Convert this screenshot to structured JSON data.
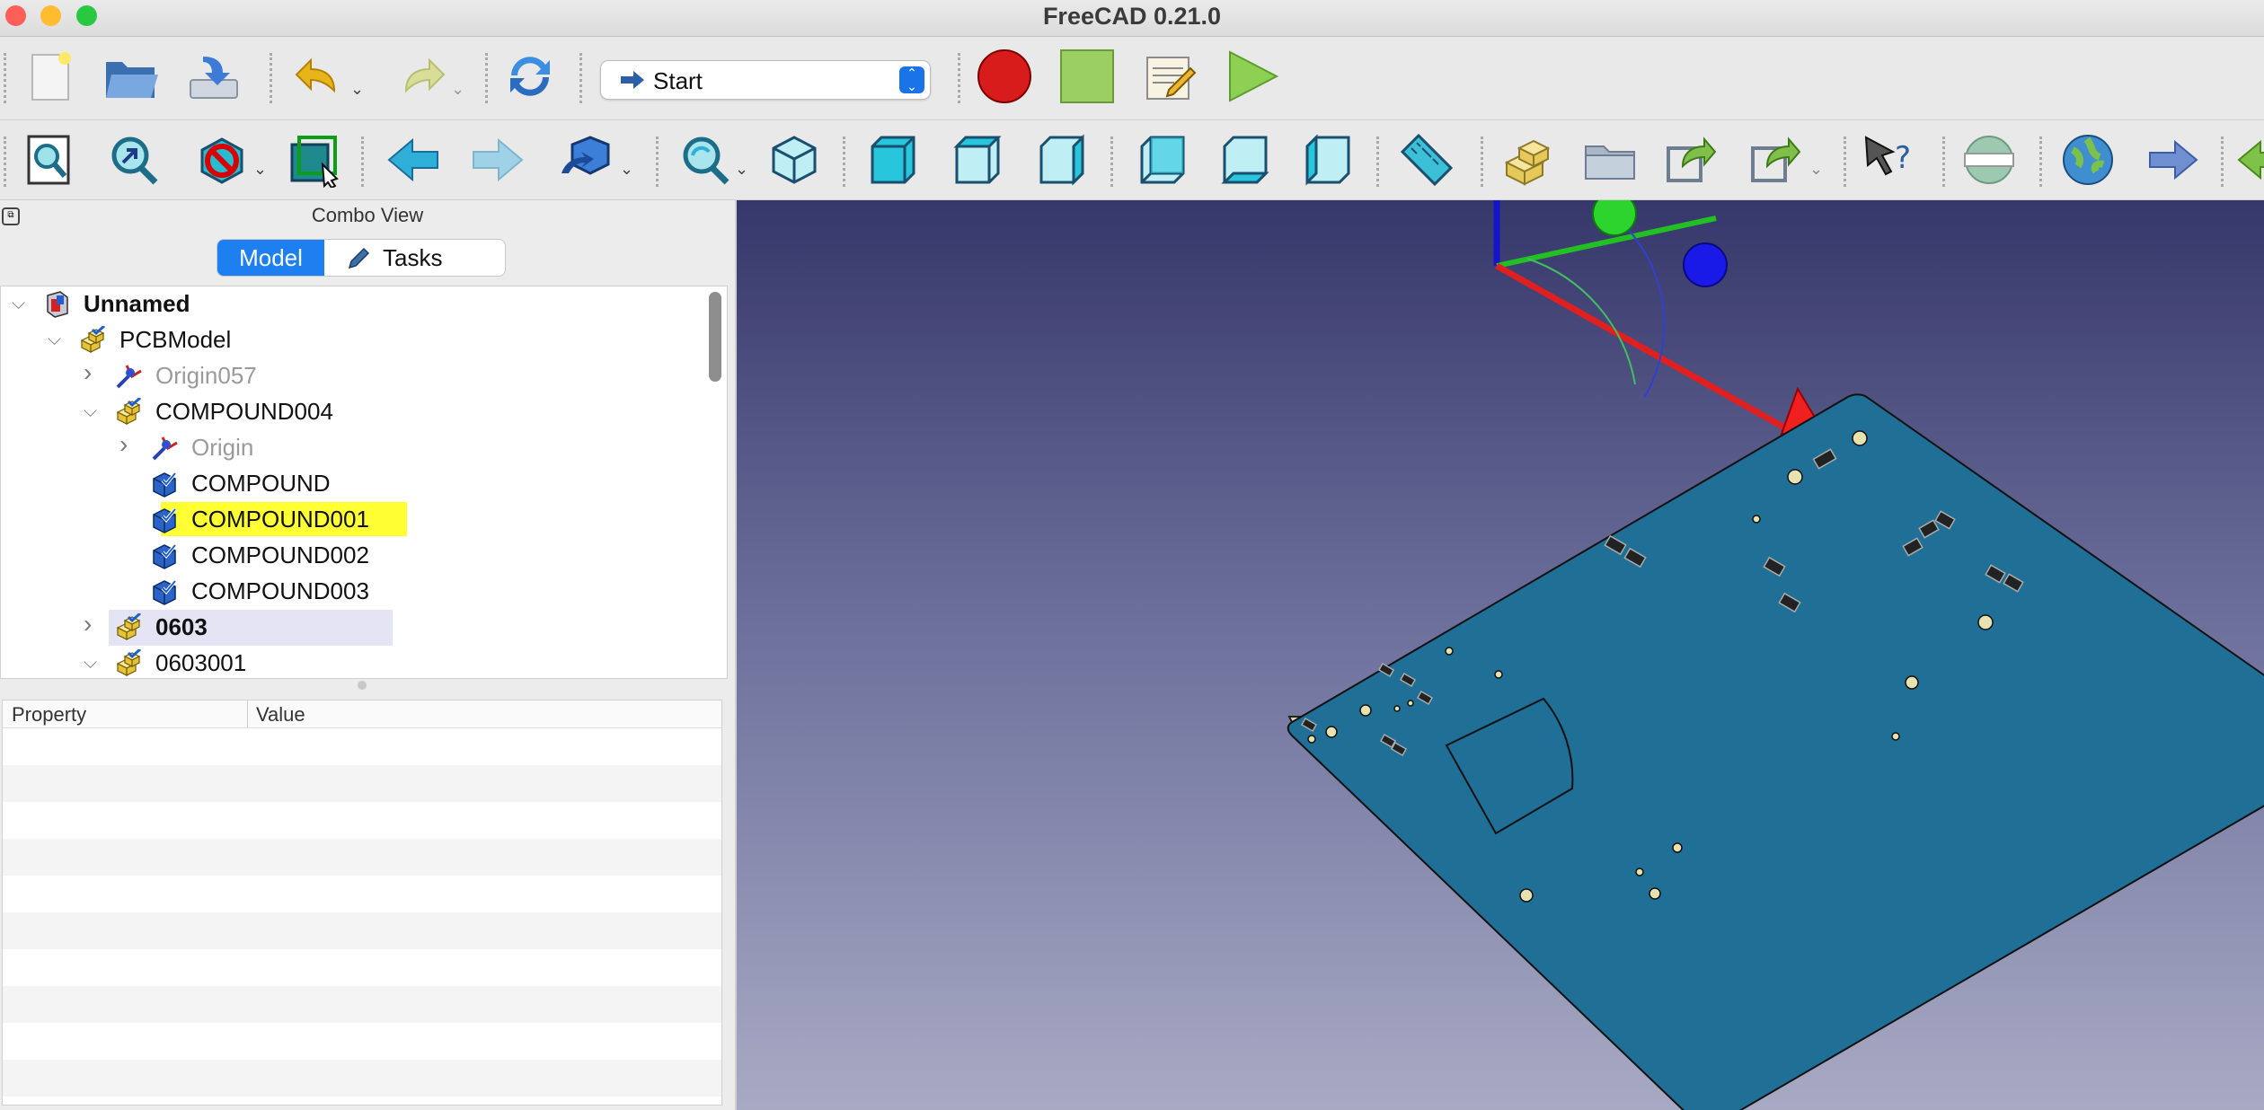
{
  "window": {
    "title": "FreeCAD 0.21.0",
    "traffic_lights": {
      "close": "#ff5f57",
      "minimize": "#febc2e",
      "zoom": "#28c840"
    }
  },
  "toolbar1": {
    "icons": [
      "new-document-icon",
      "open-folder-icon",
      "save-icon",
      "undo-icon",
      "redo-icon",
      "refresh-icon",
      "macro-record-icon",
      "macro-stop-icon",
      "macro-edit-icon",
      "macro-run-icon"
    ],
    "workbench_selector": {
      "value": "Start"
    }
  },
  "toolbar2": {
    "icons": [
      "fit-all-icon",
      "fit-selection-icon",
      "draw-style-icon",
      "bounding-box-icon",
      "back-view-icon",
      "forward-view-icon",
      "sync-view-icon",
      "view-zoom-icon",
      "isometric-view-icon",
      "front-view-icon",
      "top-view-icon",
      "right-view-icon",
      "rear-view-icon",
      "bottom-view-icon",
      "left-view-icon",
      "measure-distance-icon",
      "part-icon",
      "group-icon",
      "link-icon",
      "link-actions-icon",
      "whats-this-icon",
      "web-navigation-icon",
      "web-home-icon",
      "web-forward-icon"
    ]
  },
  "combo_view": {
    "title": "Combo View",
    "tabs": [
      {
        "label": "Model",
        "active": true
      },
      {
        "label": "Tasks",
        "active": false
      }
    ]
  },
  "tree": {
    "items": [
      {
        "label": "Unnamed",
        "bold": true,
        "expander": "open",
        "icon": "document-icon",
        "level": 0,
        "highlight": "none",
        "dimmed": false
      },
      {
        "label": "PCBModel",
        "bold": false,
        "expander": "open",
        "icon": "part-icon",
        "level": 1,
        "highlight": "none",
        "dimmed": false
      },
      {
        "label": "Origin057",
        "bold": false,
        "expander": "closed",
        "icon": "origin-icon",
        "level": 2,
        "highlight": "none",
        "dimmed": true
      },
      {
        "label": "COMPOUND004",
        "bold": false,
        "expander": "open",
        "icon": "part-icon",
        "level": 2,
        "highlight": "none",
        "dimmed": false
      },
      {
        "label": "Origin",
        "bold": false,
        "expander": "closed",
        "icon": "origin-icon",
        "level": 3,
        "highlight": "none",
        "dimmed": true
      },
      {
        "label": "COMPOUND",
        "bold": false,
        "expander": "none",
        "icon": "compound-icon",
        "level": 3,
        "highlight": "none",
        "dimmed": false
      },
      {
        "label": "COMPOUND001",
        "bold": false,
        "expander": "none",
        "icon": "compound-icon",
        "level": 3,
        "highlight": "selected",
        "dimmed": false
      },
      {
        "label": "COMPOUND002",
        "bold": false,
        "expander": "none",
        "icon": "compound-icon",
        "level": 3,
        "highlight": "none",
        "dimmed": false
      },
      {
        "label": "COMPOUND003",
        "bold": false,
        "expander": "none",
        "icon": "compound-icon",
        "level": 3,
        "highlight": "none",
        "dimmed": false
      },
      {
        "label": "0603",
        "bold": true,
        "expander": "closed",
        "icon": "part-icon",
        "level": 2,
        "highlight": "hover",
        "dimmed": false
      },
      {
        "label": "0603001",
        "bold": false,
        "expander": "open",
        "icon": "part-icon",
        "level": 2,
        "highlight": "none",
        "dimmed": false
      }
    ]
  },
  "property_editor": {
    "columns": [
      "Property",
      "Value"
    ]
  },
  "colors": {
    "selection": "#ffff33",
    "hover": "#e4e4f5",
    "accent": "#1d7ff0",
    "pcb_top": "#1f6f96",
    "pcb_edge": "#d8d5a6"
  }
}
